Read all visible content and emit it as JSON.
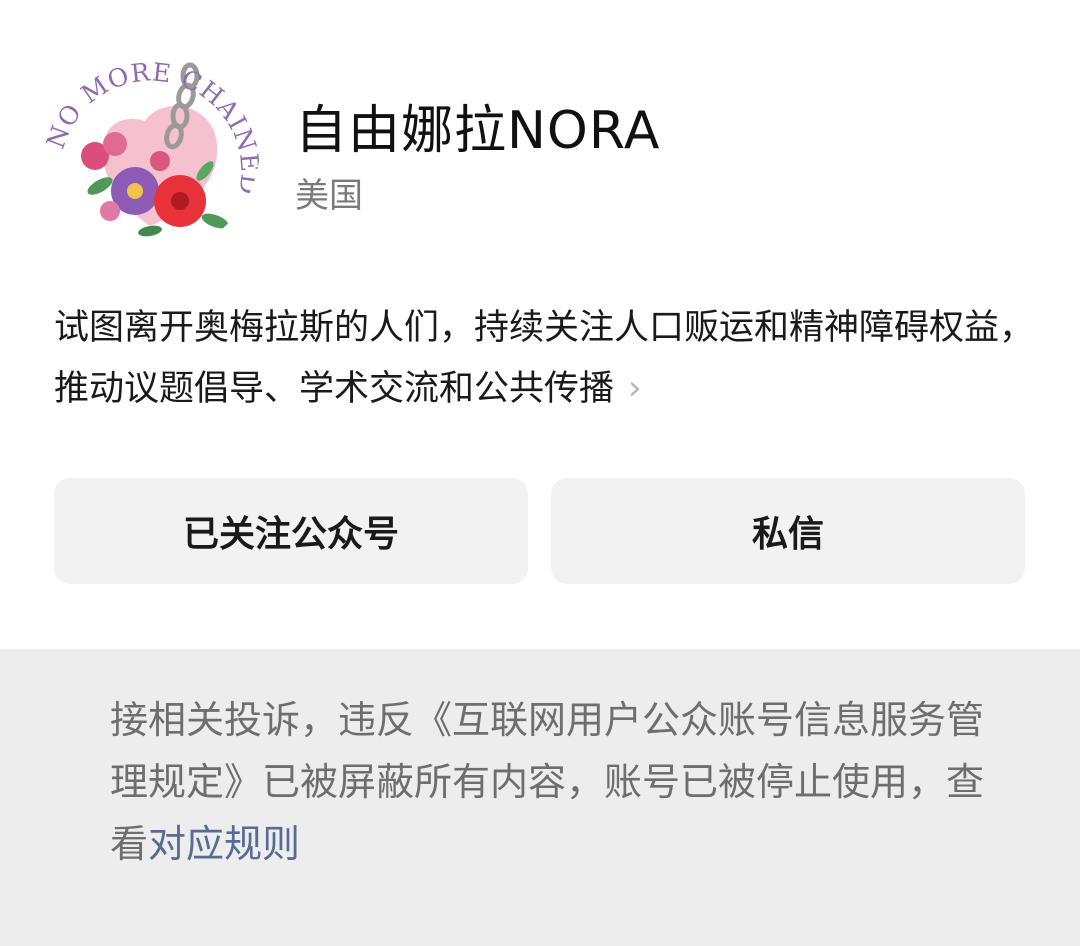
{
  "profile": {
    "name": "自由娜拉NORA",
    "region": "美国",
    "avatar_text": "NO MORE CHAINED"
  },
  "bio": {
    "text": "试图离开奥梅拉斯的人们，持续关注人口贩运和精神障碍权益，推动议题倡导、学术交流和公共传播",
    "chevron": "›"
  },
  "actions": {
    "follow_label": "已关注公众号",
    "message_label": "私信"
  },
  "notice": {
    "text": "接相关投诉，违反《互联网用户公众账号信息服务管理规定》已被屏蔽所有内容，账号已被停止使用，查看",
    "link_text": "对应规则"
  },
  "colors": {
    "link": "#576b95",
    "notice_bg": "#ededed",
    "button_bg": "#f2f2f2"
  }
}
